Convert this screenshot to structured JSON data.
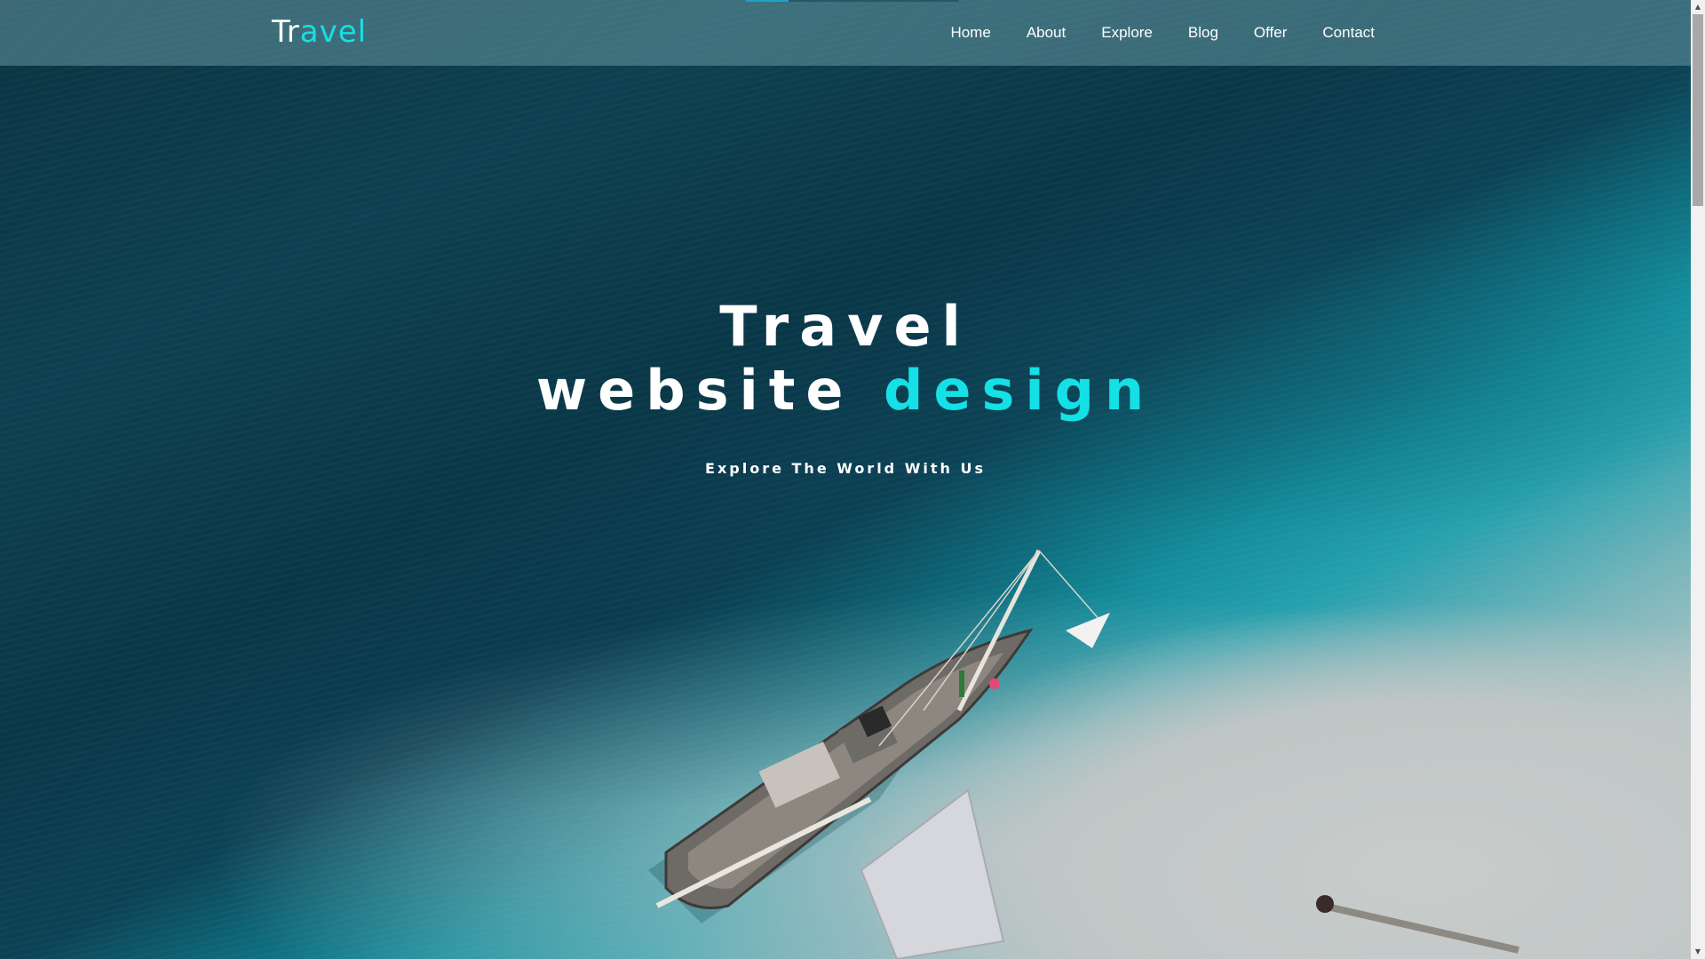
{
  "header": {
    "brand_part1": "Tr",
    "brand_part2": "avel",
    "nav": [
      {
        "label": "Home"
      },
      {
        "label": "About"
      },
      {
        "label": "Explore"
      },
      {
        "label": "Blog"
      },
      {
        "label": "Offer"
      },
      {
        "label": "Contact"
      }
    ]
  },
  "hero": {
    "title_line1": "Travel",
    "title_line2_part1": "website ",
    "title_line2_part2": "design",
    "subtitle": "Explore The World With Us"
  },
  "colors": {
    "accent": "#14e0e6",
    "text": "#ffffff",
    "navbar_bg": "rgba(120,170,180,0.45)"
  },
  "icons": {
    "scroll_up": "arrow-up-icon",
    "scroll_down": "arrow-down-icon"
  }
}
